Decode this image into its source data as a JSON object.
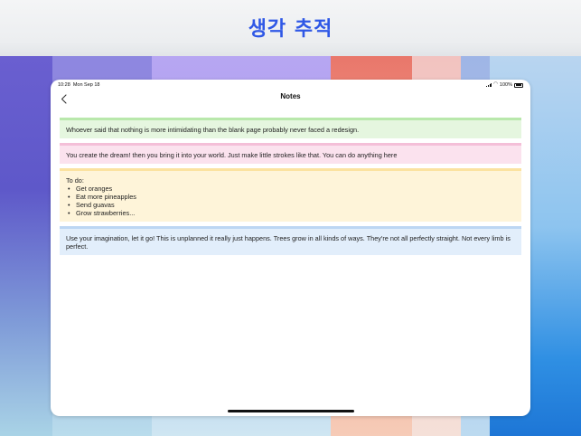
{
  "headline": "생각 추적",
  "status_bar": {
    "time": "10:28",
    "date": "Mon Sep 18",
    "battery": "100%"
  },
  "nav": {
    "title": "Notes",
    "back_icon": "chevron-left-icon"
  },
  "notes": [
    {
      "color": "#e5f6df",
      "text": "Whoever said that nothing is more intimidating than the blank page probably never faced a redesign."
    },
    {
      "color": "#fbe2ee",
      "text": "You create the dream! then you bring it into your world. Just make little strokes like that. You can do anything here"
    },
    {
      "color": "#fef4d9",
      "title": "To do:",
      "items": [
        "Get oranges",
        "Eat more pineapples",
        "Send guavas",
        "Grow strawberries..."
      ]
    },
    {
      "color": "#e2eefb",
      "text": "Use your imagination, let it go! This is unplanned it really just happens. Trees grow in all kinds of ways. They're not all perfectly straight. Not every limb is perfect."
    }
  ],
  "accent_color": "#2f58e6"
}
